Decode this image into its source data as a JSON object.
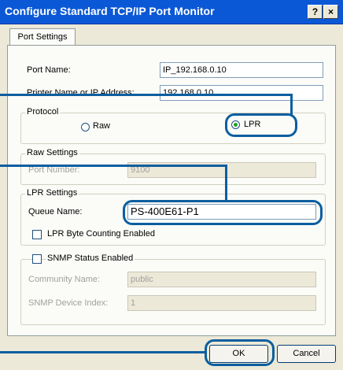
{
  "window": {
    "title": "Configure Standard TCP/IP Port Monitor",
    "help_glyph": "?",
    "close_glyph": "×",
    "tab_label": "Port Settings"
  },
  "port": {
    "name_label": "Port Name:",
    "name_value": "IP_192.168.0.10",
    "printer_label": "Printer Name or IP Address:",
    "printer_value": "192.168.0.10"
  },
  "protocol": {
    "title": "Protocol",
    "raw_label": "Raw",
    "lpr_label": "LPR",
    "selected": "LPR"
  },
  "raw_settings": {
    "title": "Raw Settings",
    "port_number_label": "Port Number:",
    "port_number_value": "9100"
  },
  "lpr_settings": {
    "title": "LPR Settings",
    "queue_label": "Queue Name:",
    "queue_value": "PS-400E61-P1",
    "byte_counting_label": "LPR Byte Counting Enabled",
    "byte_counting_checked": false
  },
  "snmp": {
    "title": "SNMP Status Enabled",
    "checked": false,
    "community_label": "Community Name:",
    "community_value": "public",
    "device_index_label": "SNMP Device Index:",
    "device_index_value": "1"
  },
  "buttons": {
    "ok": "OK",
    "cancel": "Cancel"
  },
  "colors": {
    "titlebar": "#0a58d6",
    "dialog": "#ece9d8",
    "callout": "#0b5ea0"
  }
}
